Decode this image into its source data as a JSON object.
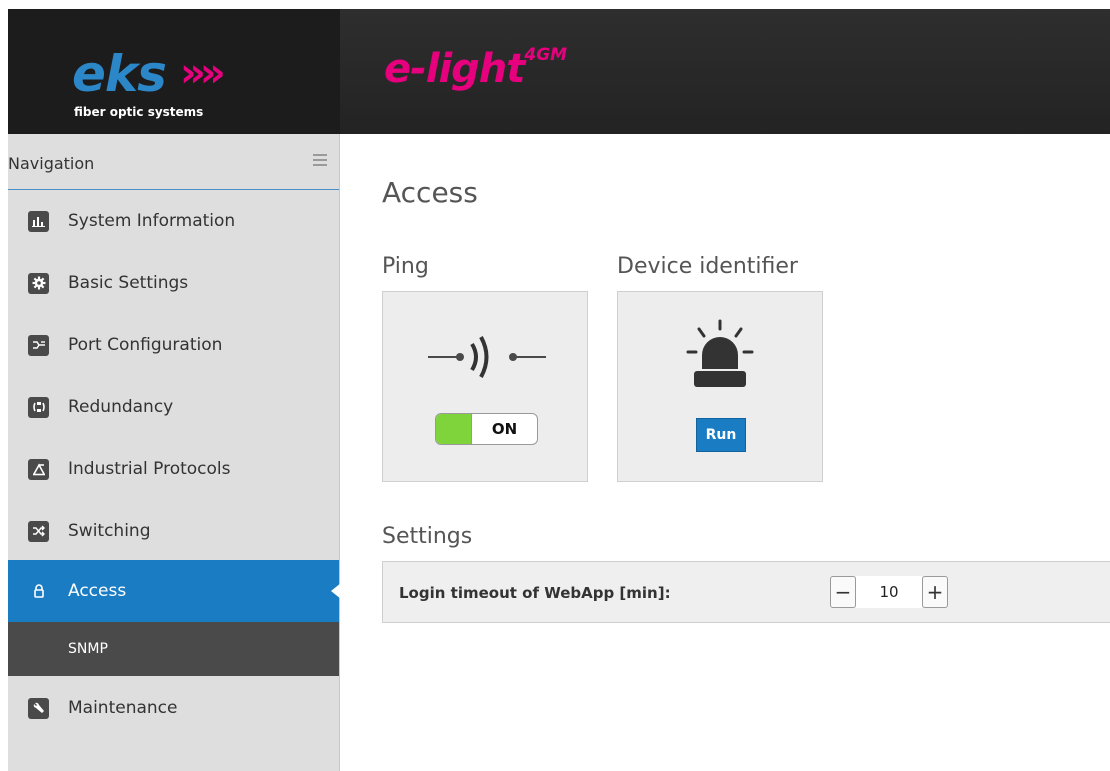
{
  "header": {
    "brand": "eks",
    "brand_chevrons": "»",
    "tagline": "fiber optic systems",
    "product": "e-light",
    "product_suffix": "4GM"
  },
  "sidebar": {
    "title": "Navigation",
    "items": [
      {
        "label": "System Information",
        "icon": "chart-icon"
      },
      {
        "label": "Basic Settings",
        "icon": "gear-icon"
      },
      {
        "label": "Port Configuration",
        "icon": "port-icon"
      },
      {
        "label": "Redundancy",
        "icon": "redundancy-icon"
      },
      {
        "label": "Industrial Protocols",
        "icon": "protocol-icon"
      },
      {
        "label": "Switching",
        "icon": "shuffle-icon"
      },
      {
        "label": "Access",
        "icon": "lock-icon",
        "active": true
      },
      {
        "label": "Maintenance",
        "icon": "wrench-icon"
      }
    ],
    "sub_item": "SNMP"
  },
  "main": {
    "title": "Access",
    "ping": {
      "title": "Ping",
      "toggle_label": "ON"
    },
    "identifier": {
      "title": "Device identifier",
      "button_label": "Run"
    },
    "settings": {
      "title": "Settings",
      "login_timeout_label": "Login timeout of WebApp [min]:",
      "login_timeout_value": "10",
      "minus": "−",
      "plus": "+"
    }
  },
  "colors": {
    "accent": "#1a7cc2",
    "brand_blue": "#2c87c8",
    "brand_pink": "#e6007e",
    "toggle_on": "#7fd33b"
  }
}
